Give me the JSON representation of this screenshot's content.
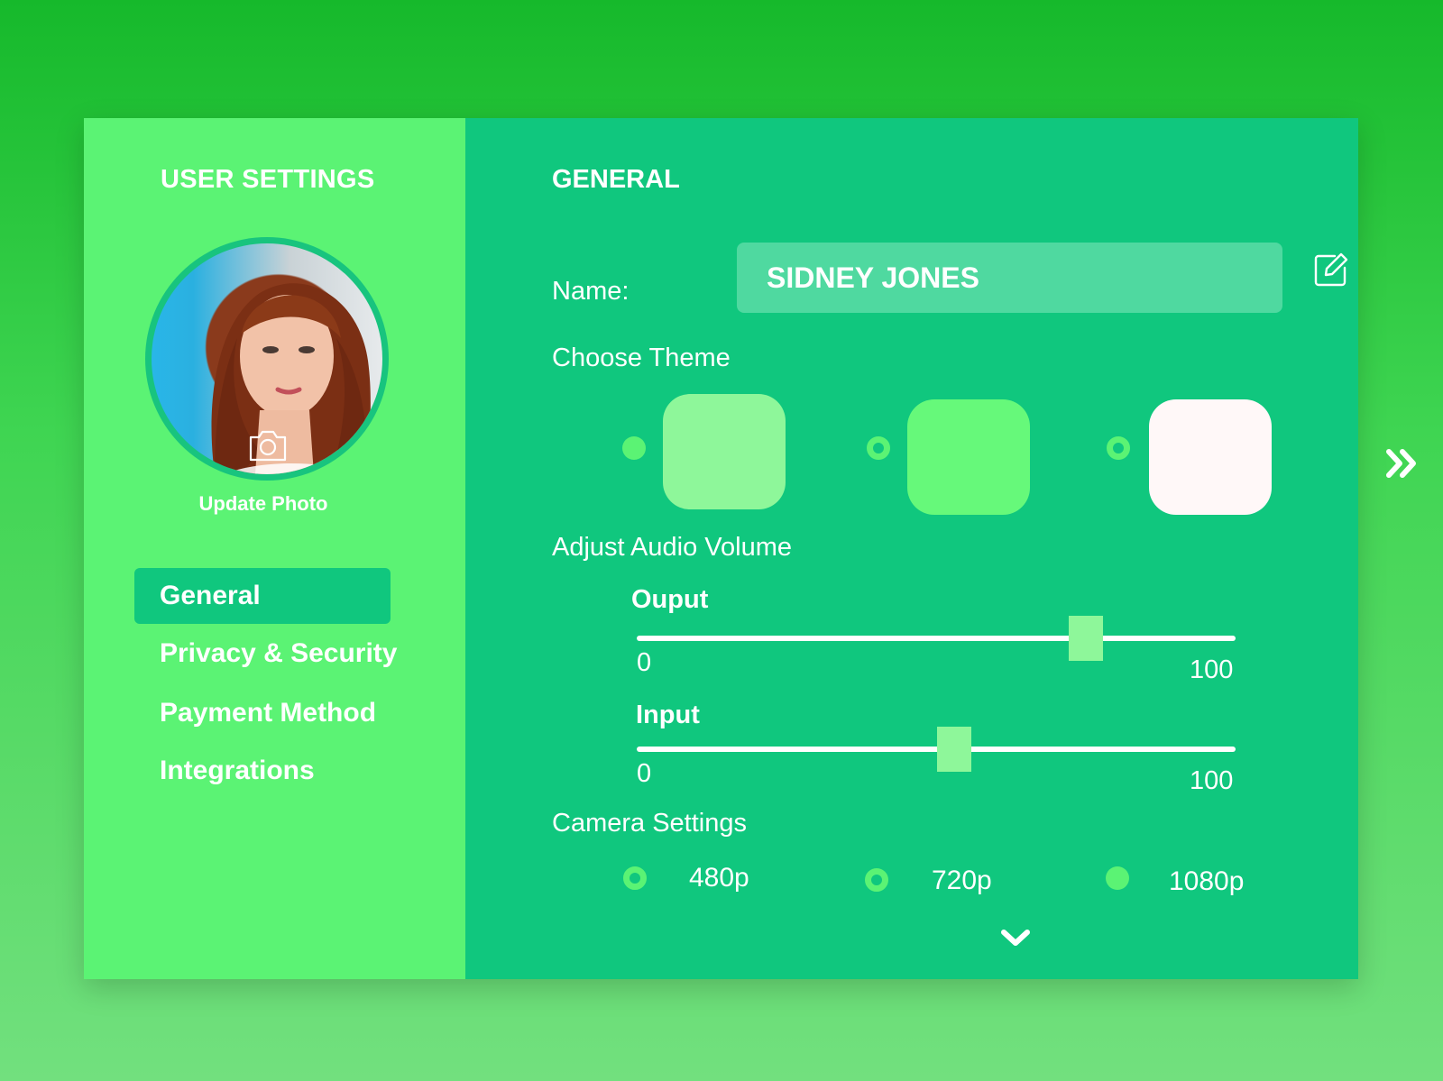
{
  "colors": {
    "background_top": "#16b92b",
    "sidebar": "#5bf374",
    "main": "#10c77e",
    "accent_light": "#8ef79a",
    "theme_swatches": [
      "#8ef79a",
      "#66f97a",
      "#fff8f8"
    ]
  },
  "sidebar": {
    "title": "USER SETTINGS",
    "update_photo": "Update Photo",
    "camera_icon": "camera-icon",
    "items": [
      {
        "label": "General",
        "active": true
      },
      {
        "label": "Privacy & Security",
        "active": false
      },
      {
        "label": "Payment Method",
        "active": false
      },
      {
        "label": "Integrations",
        "active": false
      }
    ]
  },
  "main": {
    "title": "GENERAL",
    "name_label": "Name:",
    "name_value": "SIDNEY JONES",
    "edit_icon": "pencil-square-icon",
    "theme_label": "Choose Theme",
    "theme_selected_index": 0,
    "more_themes_icon": "double-chevron-right-icon",
    "audio_label": "Adjust Audio Volume",
    "output": {
      "label": "Ouput",
      "min": "0",
      "max": "100",
      "value": 75
    },
    "input": {
      "label": "Input",
      "min": "0",
      "max": "100",
      "value": 53
    },
    "camera_label": "Camera Settings",
    "camera_options": [
      "480p",
      "720p",
      "1080p"
    ],
    "camera_selected_index": 2,
    "scroll_icon": "chevron-down-icon"
  }
}
